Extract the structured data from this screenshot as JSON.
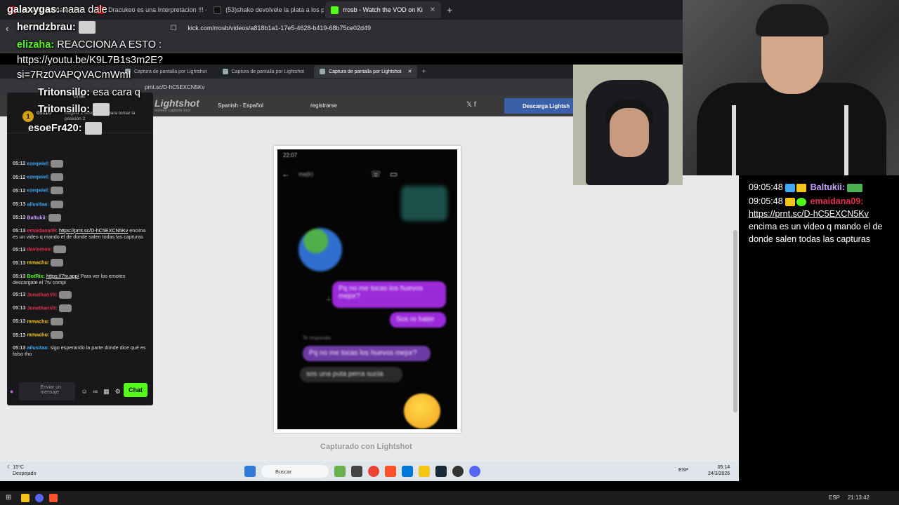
{
  "outer_browser": {
    "tabs": [
      {
        "label": "galaaxygas: naaa dale",
        "active": false,
        "color": "#ff0000"
      },
      {
        "label": "Dracukeo es una Interpretacion !!! - Y",
        "active": false,
        "color": "#ff0000"
      },
      {
        "label": "(53)shako devolvele la plata a los pib",
        "active": false,
        "color": "#111111"
      },
      {
        "label": "rrosb - Watch the VOD on Ki",
        "active": true,
        "color": "#53fc18"
      }
    ],
    "url": "kick.com/rrosb/videos/a818b1a1-17e5-4628-b419-68b75ce02d49"
  },
  "inner_browser": {
    "tabs": [
      {
        "label": "Captura de pantalla por Lightshot",
        "active": false
      },
      {
        "label": "Captura de pantalla por Lightshot",
        "active": false
      },
      {
        "label": "Captura de pantalla por Lightshot",
        "active": true
      }
    ],
    "url": "prnt.sc/D-hC5EXCN5Kv"
  },
  "lightshot": {
    "logo": "Lightshot",
    "tagline": "screen capture tool",
    "language": "Spanish - Español",
    "register": "registrarse",
    "download_btn": "Descarga Lightsh",
    "caption": "Capturado con Lightshot"
  },
  "phone": {
    "time": "22:07",
    "contact": "ma(lr)",
    "bubbles": [
      "Pq no me tocas los huevos mejor?",
      "Sos re hater",
      "Pq no me tocas los huevos mejor?",
      "sos una puta perra sucia"
    ],
    "replied": "Te respondió"
  },
  "inner_chat": {
    "header": "Chat",
    "gift_user": "os11o",
    "gift_count": "1",
    "gift_text": "Regala 1 suscripción para tomar la posición 2",
    "messages": [
      {
        "time": "05:12",
        "user": "ezeqwiel:",
        "color": "#3fa9f5",
        "text": ""
      },
      {
        "time": "05:12",
        "user": "ezeqwiel:",
        "color": "#3fa9f5",
        "text": ""
      },
      {
        "time": "05:12",
        "user": "ezeqwiel:",
        "color": "#3fa9f5",
        "text": ""
      },
      {
        "time": "05:13",
        "user": "ailusitaa:",
        "color": "#3fa9f5",
        "text": ""
      },
      {
        "time": "05:13",
        "user": "Baltukii:",
        "color": "#c9a0ff",
        "text": ""
      },
      {
        "time": "05:13",
        "user": "emaidana09:",
        "color": "#e2304a",
        "text": "encima es un video q mando el de donde salen todas las capturas",
        "link": "https://prnt.sc/D-hC5EXCN5Kv"
      },
      {
        "time": "05:13",
        "user": "davismoo:",
        "color": "#e2304a",
        "text": ""
      },
      {
        "time": "05:13",
        "user": "mmachu:",
        "color": "#f5c518",
        "text": ""
      },
      {
        "time": "05:13",
        "user": "BotRix:",
        "color": "#53fc18",
        "text": "Para ver los emotes descargate el 7tv compi",
        "link": "https://7tv.app/"
      },
      {
        "time": "05:13",
        "user": "JonathanVit:",
        "color": "#e2304a",
        "text": ""
      },
      {
        "time": "05:13",
        "user": "JonathanVit:",
        "color": "#e2304a",
        "text": ""
      },
      {
        "time": "05:13",
        "user": "mmachu:",
        "color": "#f5c518",
        "text": ""
      },
      {
        "time": "05:13",
        "user": "mmachu:",
        "color": "#f5c518",
        "text": ""
      },
      {
        "time": "05:13",
        "user": "ailusitaa:",
        "color": "#3fa9f5",
        "text": "sigo esperando la parte donde dice qué es falso tho"
      }
    ],
    "input_placeholder": "Enviar un mensaje",
    "chat_button": "Chat"
  },
  "inner_taskbar": {
    "temp": "15°C",
    "weather": "Despejado",
    "search": "Buscar",
    "lang": "ESP",
    "time": "05:14",
    "date": "24/3/2026"
  },
  "outer_taskbar": {
    "lang": "ESP",
    "time": "21:13:42"
  },
  "overlay_chat": [
    {
      "user": "galaxygas:",
      "text": "naaa dale"
    },
    {
      "user": "herndzbrau:",
      "text": ""
    },
    {
      "user": "elizaha:",
      "text": "REACCIONA A ESTO :"
    },
    {
      "user": "",
      "text": "https://youtu.be/K9L7B1s3m2E?"
    },
    {
      "user": "",
      "text": "si=7Rz0VAPQVACmWmI"
    },
    {
      "user": "Tritonsillo:",
      "text": "esa cara q"
    },
    {
      "user": "Tritonsillo:",
      "text": ""
    },
    {
      "user": "esoeFr420:",
      "text": ""
    }
  ],
  "right_chat": [
    {
      "time": "09:05:48",
      "user": "Baltukii:",
      "color": "#c9a0ff",
      "text": ""
    },
    {
      "time": "09:05:48",
      "user": "emaidana09:",
      "color": "#e2304a",
      "link": "https://prnt.sc/D-hC5EXCN5Kv",
      "text": "encima es un video q mando el de donde salen todas las capturas"
    }
  ]
}
